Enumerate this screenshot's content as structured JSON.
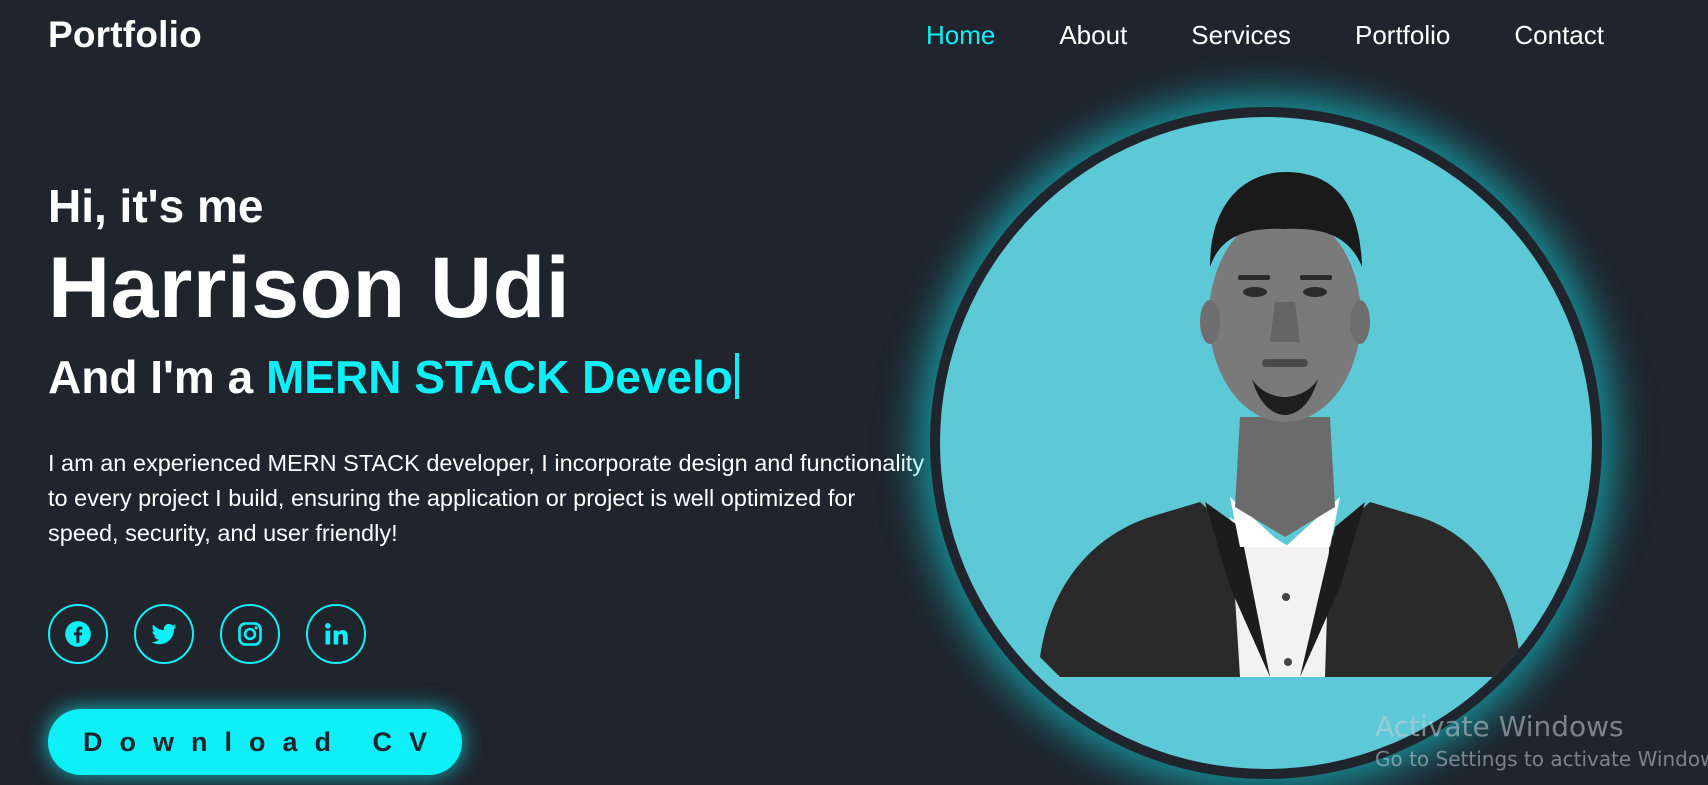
{
  "header": {
    "logo": "Portfolio",
    "nav": [
      {
        "label": "Home",
        "active": true
      },
      {
        "label": "About",
        "active": false
      },
      {
        "label": "Services",
        "active": false
      },
      {
        "label": "Portfolio",
        "active": false
      },
      {
        "label": "Contact",
        "active": false
      }
    ]
  },
  "hero": {
    "greeting": "Hi, it's me",
    "name": "Harrison Udi",
    "role_prefix": "And I'm a ",
    "role_typed": "MERN STACK Develo",
    "bio": "I am an experienced MERN STACK developer, I incorporate design and functionality to every project I build, ensuring the application or project is well optimized for speed, security, and user friendly!",
    "socials": [
      {
        "icon": "facebook-icon"
      },
      {
        "icon": "twitter-icon"
      },
      {
        "icon": "instagram-icon"
      },
      {
        "icon": "linkedin-icon"
      }
    ],
    "cv_button": "Download CV"
  },
  "watermark": {
    "title": "Activate Windows",
    "subtitle": "Go to Settings to activate Windows."
  },
  "colors": {
    "background": "#1f242d",
    "accent": "#0ef0f8",
    "portrait_bg": "#5ec9d6",
    "text": "#ffffff"
  }
}
